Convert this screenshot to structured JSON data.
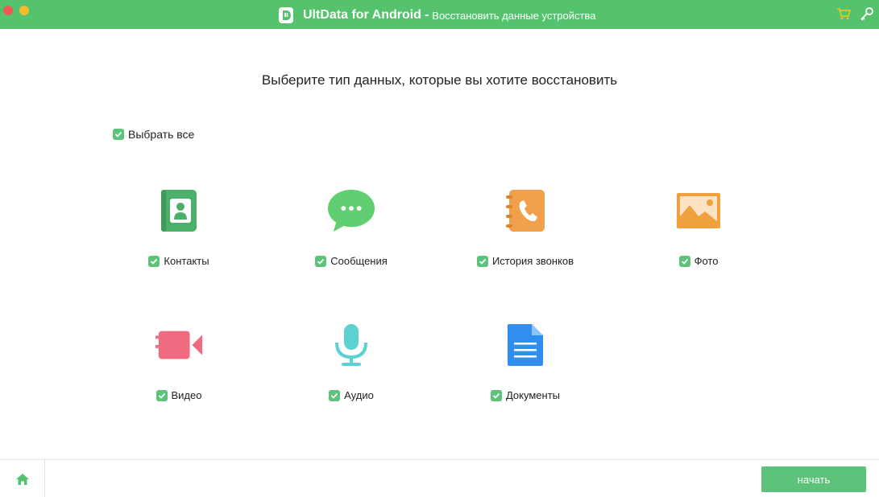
{
  "titlebar": {
    "app_name": "UltData for Android",
    "separator": "-",
    "subtitle": "Восстановить данные устройства"
  },
  "heading": "Выберите тип данных, которые вы хотите восстановить",
  "select_all": {
    "label": "Выбрать все",
    "checked": true
  },
  "data_types": [
    {
      "label": "Контакты",
      "icon": "contacts-icon",
      "checked": true
    },
    {
      "label": "Сообщения",
      "icon": "messages-icon",
      "checked": true
    },
    {
      "label": "История звонков",
      "icon": "call-history-icon",
      "checked": true
    },
    {
      "label": "Фото",
      "icon": "photo-icon",
      "checked": true
    },
    {
      "label": "Видео",
      "icon": "video-icon",
      "checked": true
    },
    {
      "label": "Аудио",
      "icon": "audio-icon",
      "checked": true
    },
    {
      "label": "Документы",
      "icon": "documents-icon",
      "checked": true
    }
  ],
  "footer": {
    "start_label": "начать"
  },
  "colors": {
    "brand_green": "#55c26e",
    "checkbox_green": "#5ec37a",
    "contacts": "#4caf6a",
    "messages": "#5fcf72",
    "calls": "#f2a04c",
    "photo": "#f0a03c",
    "video": "#ee6b80",
    "audio": "#5cd1d0",
    "documents": "#2f8ef0"
  }
}
